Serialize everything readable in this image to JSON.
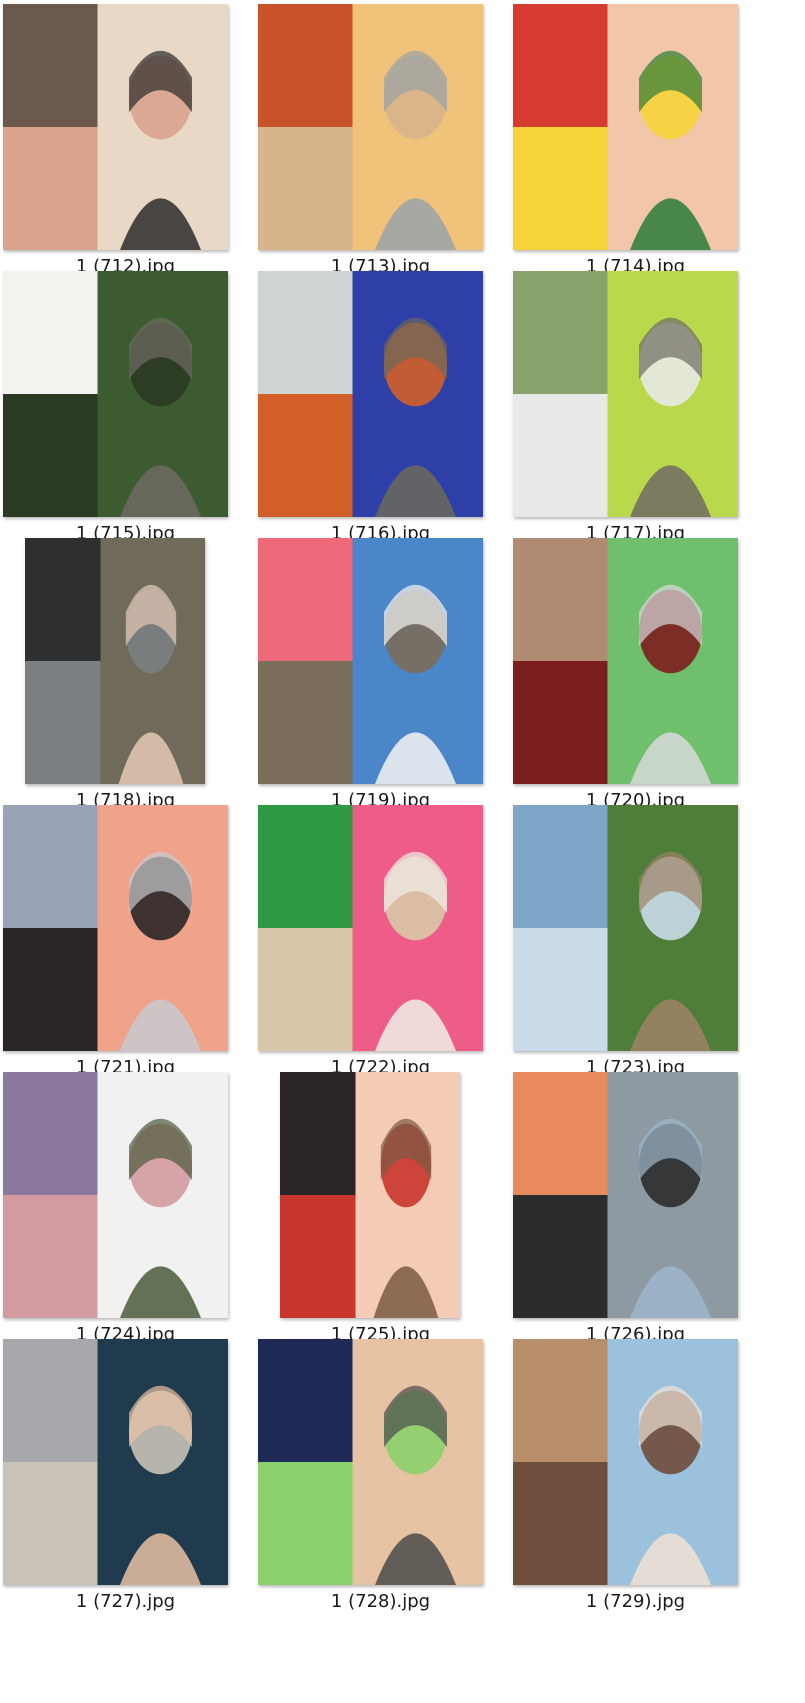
{
  "files": [
    {
      "name": "1 (712).jpg",
      "icon": "image-thumbnail-icon",
      "colors": [
        "#6b5a4c",
        "#e9d8c6",
        "#2b2b2b",
        "#d9a38e"
      ]
    },
    {
      "name": "1 (713).jpg",
      "icon": "image-thumbnail-icon",
      "colors": [
        "#c8532a",
        "#f0c27a",
        "#9aa3a8",
        "#d7b48a"
      ]
    },
    {
      "name": "1 (714).jpg",
      "icon": "image-thumbnail-icon",
      "colors": [
        "#d63b2f",
        "#f2c6a8",
        "#2c7a3a",
        "#f7d33a"
      ]
    },
    {
      "name": "1 (715).jpg",
      "icon": "image-thumbnail-icon",
      "colors": [
        "#f3f2ef",
        "#3d5b31",
        "#6e6b63",
        "#2a3a24"
      ]
    },
    {
      "name": "1 (716).jpg",
      "icon": "image-thumbnail-icon",
      "colors": [
        "#cfd3d3",
        "#2e3fa8",
        "#6a6a5c",
        "#d35f28"
      ]
    },
    {
      "name": "1 (717).jpg",
      "icon": "image-thumbnail-icon",
      "colors": [
        "#8aa36c",
        "#b9d84c",
        "#6e6b63",
        "#e7e9e6"
      ]
    },
    {
      "name": "1 (718).jpg",
      "icon": "image-thumbnail-icon",
      "colors": [
        "#2d2f31",
        "#6f6a5a",
        "#e6c9b5",
        "#7b7f82"
      ]
    },
    {
      "name": "1 (719).jpg",
      "icon": "image-thumbnail-icon",
      "colors": [
        "#ee6a7a",
        "#4a86c8",
        "#f4f4f2",
        "#7a6d5a"
      ]
    },
    {
      "name": "1 (720).jpg",
      "icon": "image-thumbnail-icon",
      "colors": [
        "#b08a72",
        "#6fbf6c",
        "#d8d9db",
        "#7c1d1f"
      ]
    },
    {
      "name": "1 (721).jpg",
      "icon": "image-thumbnail-icon",
      "colors": [
        "#9aa3b6",
        "#f0a38b",
        "#c8c9cf",
        "#2a2626"
      ]
    },
    {
      "name": "1 (722).jpg",
      "icon": "image-thumbnail-icon",
      "colors": [
        "#2f9a45",
        "#ee5d87",
        "#f1eee8",
        "#d8c7a7"
      ]
    },
    {
      "name": "1 (723).jpg",
      "icon": "image-thumbnail-icon",
      "colors": [
        "#7fa6c8",
        "#4f7d3a",
        "#9e8266",
        "#c9dbe9"
      ]
    },
    {
      "name": "1 (724).jpg",
      "icon": "image-thumbnail-icon",
      "colors": [
        "#8d78a0",
        "#f1f1f1",
        "#4b5a3c",
        "#d39aa0"
      ]
    },
    {
      "name": "1 (725).jpg",
      "icon": "image-thumbnail-icon",
      "colors": [
        "#2b2426",
        "#f4cbb4",
        "#7b5a44",
        "#c9352d"
      ]
    },
    {
      "name": "1 (726).jpg",
      "icon": "image-thumbnail-icon",
      "colors": [
        "#e88a5e",
        "#8d9aa1",
        "#9eb6cc",
        "#2c2c2c"
      ]
    },
    {
      "name": "1 (727).jpg",
      "icon": "image-thumbnail-icon",
      "colors": [
        "#a7a8ab",
        "#1f3b4d",
        "#e9c2a5",
        "#c8c2b7"
      ]
    },
    {
      "name": "1 (728).jpg",
      "icon": "image-thumbnail-icon",
      "colors": [
        "#1e2a55",
        "#e6c3a3",
        "#4b4b4b",
        "#8bd26c"
      ]
    },
    {
      "name": "1 (729).jpg",
      "icon": "image-thumbnail-icon",
      "colors": [
        "#b88f6a",
        "#9cc1dd",
        "#f0e2d4",
        "#6f4c3b"
      ]
    }
  ]
}
